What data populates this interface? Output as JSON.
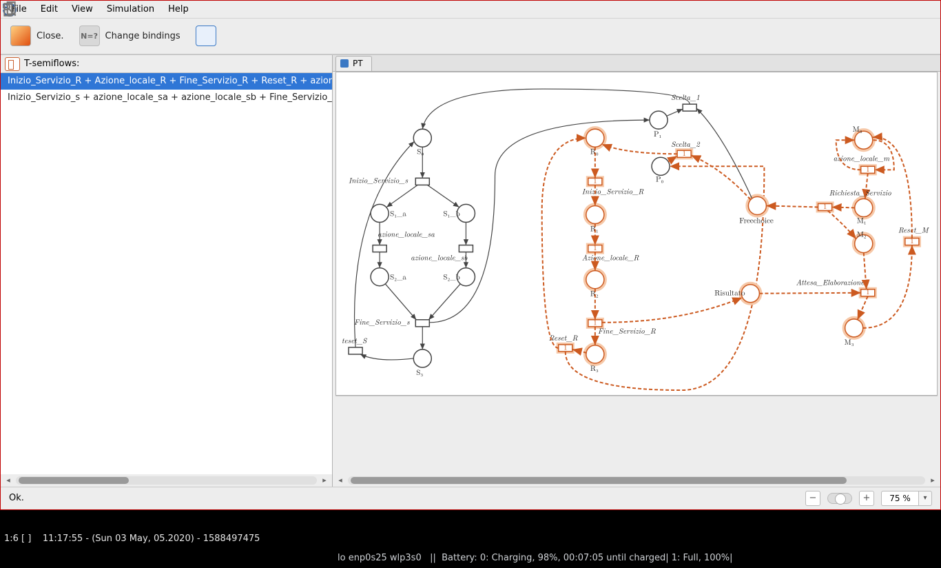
{
  "menubar": {
    "file": "File",
    "edit": "Edit",
    "view": "View",
    "simulation": "Simulation",
    "help": "Help"
  },
  "toolbar": {
    "close_label": "Close.",
    "change_bindings_label": "Change bindings"
  },
  "left": {
    "title": "T-semiflows:",
    "items": [
      "Inizio_Servizio_R + Azione_locale_R + Fine_Servizio_R + Reset_R + azion",
      "Inizio_Servizio_s + azione_locale_sa + azione_locale_sb + Fine_Servizio_"
    ]
  },
  "tab": {
    "label": "PT"
  },
  "nodes": {
    "S0": "S₀",
    "S1a": "S₁_a",
    "S1b": "S₁_b",
    "S2a": "S₂_a",
    "S2b": "S₂_b",
    "S3": "S₃",
    "R0": "R₀",
    "R1": "R₁",
    "R2": "R₂",
    "R3": "R₃",
    "P0": "P₀",
    "P1": "P₁",
    "M0": "M₀",
    "M1": "M₁",
    "M2": "M₂",
    "M3": "M₃",
    "Freechoice": "Freechoice",
    "Risultato": "Risultato"
  },
  "transitions": {
    "Inizio_Servizio_s": "Inizio_Servizio_s",
    "azione_locale_sa": "azione_locale_sa",
    "azione_locale_sb": "azione_locale_sb",
    "Fine_Servizio_s": "Fine_Servizio_s",
    "reset_S": "teset_S",
    "Inizio_Servizio_R": "Inizio_Servizio_R",
    "Azione_locale_R": "Azione_locale_R",
    "Fine_Servizio_R": "Fine_Servizio_R",
    "Reset_R": "Reset_R",
    "Scelta_1": "Scelta_1",
    "Scelta_2": "Scelta_2",
    "azione_locale_m": "azione_locale_m",
    "Richiesta_Servizio": "Richiesta_Servizio",
    "Attesa_Elaborazione": "Attesa_Elaborazione",
    "Reset_M": "Reset_M"
  },
  "highlight_weight": "1",
  "status": {
    "text": "Ok."
  },
  "zoom": {
    "value": "75 %"
  },
  "desktop": {
    "left": "1:6 [ ]    11:17:55 - (Sun 03 May, 05.2020) - 1588497475",
    "mid": "lo enp0s25 wlp3s0   ||  Battery: 0: Charging, 98%, 00:07:05 until charged| 1: Full, 100%|"
  },
  "chart_data": {
    "type": "petri-net",
    "selected_semiflow_index": 0,
    "places": [
      "S0",
      "S1_a",
      "S1_b",
      "S2_a",
      "S2_b",
      "S3",
      "R0",
      "R1",
      "R2",
      "R3",
      "P0",
      "P1",
      "Freechoice",
      "Risultato",
      "M0",
      "M1",
      "M2",
      "M3"
    ],
    "transitions": [
      "Inizio_Servizio_s",
      "azione_locale_sa",
      "azione_locale_sb",
      "Fine_Servizio_s",
      "teset_S",
      "Inizio_Servizio_R",
      "Azione_locale_R",
      "Fine_Servizio_R",
      "Reset_R",
      "Scelta_1",
      "Scelta_2",
      "azione_locale_m",
      "Richiesta_Servizio",
      "Attesa_Elaborazione",
      "Reset_M"
    ],
    "highlighted_transitions": [
      "Inizio_Servizio_R",
      "Azione_locale_R",
      "Fine_Servizio_R",
      "Reset_R",
      "Scelta_2",
      "azione_locale_m",
      "Richiesta_Servizio",
      "Attesa_Elaborazione",
      "Reset_M"
    ],
    "arcs": [
      [
        "S0",
        "Inizio_Servizio_s"
      ],
      [
        "Inizio_Servizio_s",
        "S1_a"
      ],
      [
        "Inizio_Servizio_s",
        "S1_b"
      ],
      [
        "S1_a",
        "azione_locale_sa"
      ],
      [
        "azione_locale_sa",
        "S2_a"
      ],
      [
        "S1_b",
        "azione_locale_sb"
      ],
      [
        "azione_locale_sb",
        "S2_b"
      ],
      [
        "S2_a",
        "Fine_Servizio_s"
      ],
      [
        "S2_b",
        "Fine_Servizio_s"
      ],
      [
        "Fine_Servizio_s",
        "S3"
      ],
      [
        "S3",
        "teset_S"
      ],
      [
        "teset_S",
        "S0"
      ],
      [
        "P1",
        "Scelta_1"
      ],
      [
        "Scelta_1",
        "S0"
      ],
      [
        "P0",
        "Scelta_2"
      ],
      [
        "Scelta_2",
        "R0"
      ],
      [
        "R0",
        "Inizio_Servizio_R"
      ],
      [
        "Inizio_Servizio_R",
        "R1"
      ],
      [
        "R1",
        "Azione_locale_R"
      ],
      [
        "Azione_locale_R",
        "R2"
      ],
      [
        "R2",
        "Fine_Servizio_R"
      ],
      [
        "Fine_Servizio_R",
        "R3"
      ],
      [
        "R3",
        "Reset_R"
      ],
      [
        "Reset_R",
        "R0"
      ],
      [
        "Freechoice",
        "Scelta_2"
      ],
      [
        "Freechoice",
        "Scelta_1"
      ],
      [
        "M0",
        "azione_locale_m"
      ],
      [
        "azione_locale_m",
        "M1"
      ],
      [
        "M1",
        "Richiesta_Servizio"
      ],
      [
        "Richiesta_Servizio",
        "Freechoice"
      ],
      [
        "Richiesta_Servizio",
        "M2"
      ],
      [
        "M2",
        "Attesa_Elaborazione"
      ],
      [
        "Risultato",
        "Attesa_Elaborazione"
      ],
      [
        "Attesa_Elaborazione",
        "M3"
      ],
      [
        "M3",
        "Reset_M"
      ],
      [
        "Reset_M",
        "M0"
      ],
      [
        "Fine_Servizio_s",
        "P1"
      ],
      [
        "Fine_Servizio_R",
        "Risultato"
      ],
      [
        "Reset_R",
        "P0"
      ]
    ]
  }
}
